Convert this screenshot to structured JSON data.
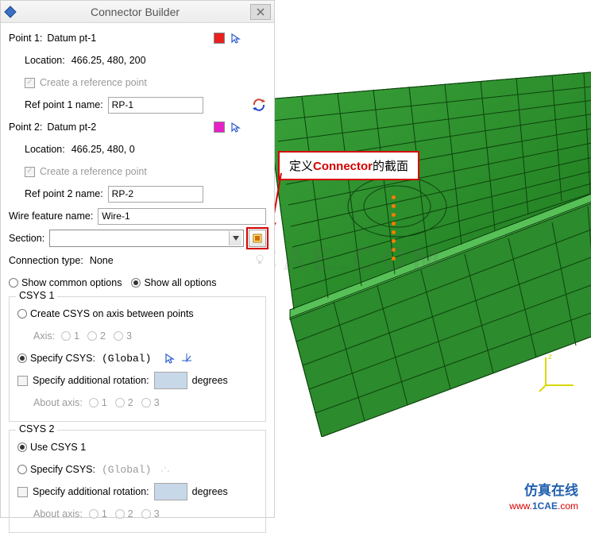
{
  "dialog": {
    "title": "Connector Builder",
    "point1": {
      "header_label": "Point 1:",
      "datum": "Datum pt-1",
      "swatch_color": "#e82020",
      "location_label": "Location:",
      "location_value": "466.25, 480, 200",
      "create_ref_label": "Create a reference point",
      "ref_name_label": "Ref point 1 name:",
      "ref_name_value": "RP-1"
    },
    "point2": {
      "header_label": "Point 2:",
      "datum": "Datum pt-2",
      "swatch_color": "#e820c8",
      "location_label": "Location:",
      "location_value": "466.25, 480, 0",
      "create_ref_label": "Create a reference point",
      "ref_name_label": "Ref point 2 name:",
      "ref_name_value": "RP-2"
    },
    "wire": {
      "label": "Wire feature name:",
      "value": "Wire-1"
    },
    "section": {
      "label": "Section:",
      "value": ""
    },
    "connection_type": {
      "label": "Connection type:",
      "value": "None"
    },
    "options": {
      "common_label": "Show common options",
      "all_label": "Show all options",
      "selected": "all"
    },
    "csys1": {
      "group_title": "CSYS 1",
      "create_on_axis_label": "Create CSYS on axis between points",
      "axis_label": "Axis:",
      "axis_1": "1",
      "axis_2": "2",
      "axis_3": "3",
      "specify_csys_label": "Specify CSYS:",
      "specify_csys_value": "(Global)",
      "specify_rot_label": "Specify additional rotation:",
      "degrees_label": "degrees",
      "about_axis_label": "About axis:"
    },
    "csys2": {
      "group_title": "CSYS 2",
      "use_csys1_label": "Use CSYS 1",
      "specify_csys_label": "Specify CSYS:",
      "specify_csys_value": "(Global)",
      "specify_rot_label": "Specify additional rotation:",
      "degrees_label": "degrees",
      "about_axis_label": "About axis:",
      "axis_1": "1",
      "axis_2": "2",
      "axis_3": "3"
    }
  },
  "callout": {
    "prefix": "定义",
    "mid": "Connector",
    "suffix": "的截面"
  },
  "watermark": "1CAE.COM",
  "footer": {
    "cn": "仿真在线",
    "url_pre": "www.",
    "url_mid": "1CAE",
    "url_suf": ".com"
  }
}
